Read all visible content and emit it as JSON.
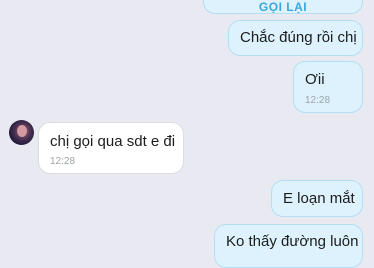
{
  "chat": {
    "callback_label": "GỌI LẠI",
    "messages": [
      {
        "text": "Chắc đúng rồi chị",
        "time": ""
      },
      {
        "text": "Ơii",
        "time": "12:28"
      },
      {
        "text": "chị gọi qua sdt e đi",
        "time": "12:28"
      },
      {
        "text": "E loạn mắt",
        "time": ""
      },
      {
        "text": "Ko thấy đường luôn",
        "time": ""
      }
    ]
  }
}
